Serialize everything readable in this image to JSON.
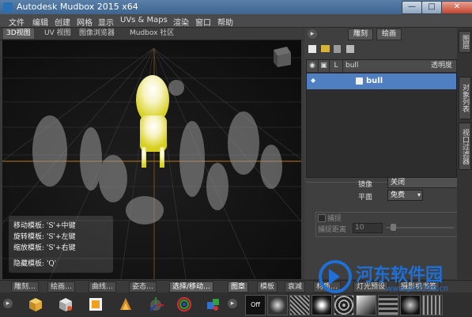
{
  "window": {
    "title": "Autodesk Mudbox 2015 x64",
    "minimize": "—",
    "maximize": "□",
    "close": "✕"
  },
  "menu": [
    "文件",
    "编辑",
    "创建",
    "网格",
    "显示",
    "UVs & Maps",
    "渲染",
    "窗口",
    "帮助"
  ],
  "view_tabs": [
    "3D视图",
    "UV 视图",
    "图像浏览器",
    "Mudbox 社区"
  ],
  "hud": {
    "lines": [
      "移动模板: 'S'+中键",
      "旋转模板: 'S'+左键",
      "缩放模板: 'S'+右键",
      "隐藏模板: 'Q'"
    ]
  },
  "right_panel": {
    "tabs": [
      "雕刻",
      "绘画"
    ],
    "layer_headers": {
      "layer": "L",
      "name": "bull",
      "opacity": "透明度"
    },
    "selected_object": "bull",
    "mirror_label": "镜像",
    "mirror_value": "关闭",
    "plane_label": "平面",
    "plane_value": "免费",
    "capture_label": "捕捉",
    "capture_distance_label": "捕捉距离",
    "capture_distance_value": "10"
  },
  "side_tabs": [
    "图层",
    "对象列表",
    "视口过滤器"
  ],
  "bottom_tabs": {
    "left": [
      "雕刻…",
      "绘画…",
      "曲线…",
      "姿态…",
      "选择/移动…"
    ],
    "right": [
      "图章",
      "模板",
      "衰减",
      "材质…",
      "灯光预设",
      "摄影机书签"
    ]
  },
  "tray": {
    "stamp_off": "Off"
  },
  "watermark": {
    "title": "河东软件园",
    "url": "www.pc0359.cn"
  },
  "colors": {
    "selection": "#4f7ec1",
    "title_bar": "#4a72a0",
    "watermark": "#1e6fd6"
  }
}
